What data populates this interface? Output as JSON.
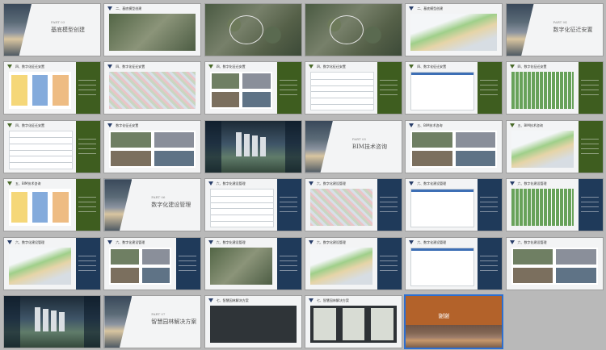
{
  "slides": [
    {
      "kind": "cover",
      "section_num": "PART 03",
      "section_title": "基底模型创建"
    },
    {
      "kind": "content",
      "title": "二、基底模型创建",
      "panel": "none",
      "photo": "aerial"
    },
    {
      "kind": "aerial"
    },
    {
      "kind": "aerial"
    },
    {
      "kind": "content",
      "title": "二、基底模型创建",
      "panel": "none",
      "photo": "model3d"
    },
    {
      "kind": "cover",
      "section_num": "PART 04",
      "section_title": "数字化征迁安置"
    },
    {
      "kind": "content",
      "title": "四、数字化征迁安置",
      "panel": "green",
      "photo": "diagram"
    },
    {
      "kind": "content",
      "title": "四、数字化征迁安置",
      "panel": "none",
      "photo": "map"
    },
    {
      "kind": "content",
      "title": "四、数字化征迁安置",
      "panel": "green",
      "photo": "photos"
    },
    {
      "kind": "content",
      "title": "四、数字化征迁安置",
      "panel": "green",
      "photo": "table"
    },
    {
      "kind": "content",
      "title": "四、数字化征迁安置",
      "panel": "green",
      "photo": "window"
    },
    {
      "kind": "content",
      "title": "四、数字化征迁安置",
      "panel": "green",
      "photo": "grid"
    },
    {
      "kind": "content",
      "title": "四、数字化征迁安置",
      "panel": "green",
      "photo": "table"
    },
    {
      "kind": "content",
      "title": "数字化征迁安置",
      "panel": "none",
      "photo": "photos"
    },
    {
      "kind": "render3d"
    },
    {
      "kind": "cover",
      "section_num": "PART 05",
      "section_title": "BIM技术咨询"
    },
    {
      "kind": "content",
      "title": "五、BIM技术咨询",
      "panel": "none",
      "photo": "photos"
    },
    {
      "kind": "content",
      "title": "五、BIM技术咨询",
      "panel": "green",
      "photo": "model3d"
    },
    {
      "kind": "content",
      "title": "五、BIM技术咨询",
      "panel": "green",
      "photo": "diagram"
    },
    {
      "kind": "cover",
      "section_num": "PART 06",
      "section_title": "数字化建设管理"
    },
    {
      "kind": "content",
      "title": "六、数字化建设管理",
      "panel": "blue",
      "photo": "table"
    },
    {
      "kind": "content",
      "title": "六、数字化建设管理",
      "panel": "blue",
      "photo": "map"
    },
    {
      "kind": "content",
      "title": "六、数字化建设管理",
      "panel": "blue",
      "photo": "window"
    },
    {
      "kind": "content",
      "title": "六、数字化建设管理",
      "panel": "blue",
      "photo": "grid"
    },
    {
      "kind": "content",
      "title": "六、数字化建设管理",
      "panel": "blue",
      "photo": "model3d"
    },
    {
      "kind": "content",
      "title": "六、数字化建设管理",
      "panel": "blue",
      "photo": "photos"
    },
    {
      "kind": "content",
      "title": "六、数字化建设管理",
      "panel": "blue",
      "photo": "aerial"
    },
    {
      "kind": "content",
      "title": "六、数字化建设管理",
      "panel": "blue",
      "photo": "model3d"
    },
    {
      "kind": "content",
      "title": "六、数字化建设管理",
      "panel": "blue",
      "photo": "window"
    },
    {
      "kind": "content",
      "title": "六、数字化建设管理",
      "panel": "none",
      "photo": "photos"
    },
    {
      "kind": "render3d"
    },
    {
      "kind": "cover",
      "section_num": "PART 07",
      "section_title": "智慧园林解决方案"
    },
    {
      "kind": "content",
      "title": "七、智慧园林解决方案",
      "panel": "none",
      "photo": "darkdiagram"
    },
    {
      "kind": "content",
      "title": "七、智慧园林解决方案",
      "panel": "none",
      "photo": "phones"
    },
    {
      "kind": "end",
      "end_title": "谢谢"
    }
  ],
  "selected_index": 34,
  "colors": {
    "green": "#3e5d1f",
    "blue": "#1f3a5a",
    "selected": "#2d6fd0",
    "end_bg": "#b3622a"
  }
}
